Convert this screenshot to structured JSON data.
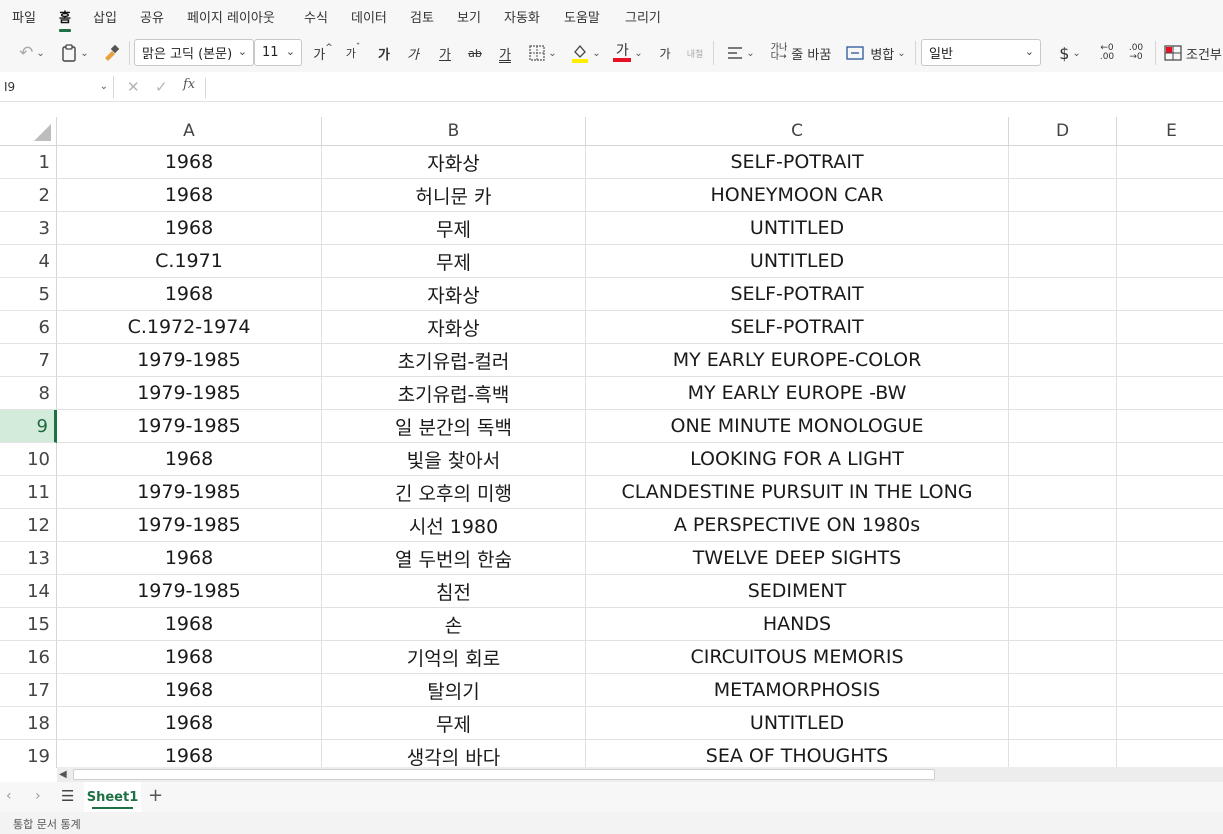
{
  "menu": {
    "items": [
      "파일",
      "홈",
      "삽입",
      "공유",
      "페이지 레이아웃",
      "수식",
      "데이터",
      "검토",
      "보기",
      "자동화",
      "도움말",
      "그리기"
    ],
    "active_index": 1
  },
  "ribbon": {
    "font_name": "맑은 고딕 (본문)",
    "font_size": "11",
    "grow_font": "가",
    "shrink_font": "가",
    "bold": "가",
    "italic": "가",
    "underline": "가",
    "strike": "ab",
    "double_underline": "가",
    "font_color": "가",
    "phonetic": "가",
    "wrap_label": "줄 바꿈",
    "merge_label": "병합",
    "number_format": "일반",
    "currency": "$",
    "conditional_label": "조건부",
    "accent_color": "#1e7145"
  },
  "formula_bar": {
    "name_box": "I9",
    "fx": "fx",
    "value": ""
  },
  "grid": {
    "columns": [
      "A",
      "B",
      "C",
      "D",
      "E"
    ],
    "selected_row": 9,
    "rows": [
      {
        "num": "1",
        "a": "1968",
        "b": "자화상",
        "c": "SELF-POTRAIT"
      },
      {
        "num": "2",
        "a": "1968",
        "b": "허니문 카",
        "c": "HONEYMOON CAR"
      },
      {
        "num": "3",
        "a": "1968",
        "b": "무제",
        "c": "UNTITLED"
      },
      {
        "num": "4",
        "a": "C.1971",
        "b": "무제",
        "c": "UNTITLED"
      },
      {
        "num": "5",
        "a": "1968",
        "b": "자화상",
        "c": "SELF-POTRAIT"
      },
      {
        "num": "6",
        "a": "C.1972-1974",
        "b": "자화상",
        "c": "SELF-POTRAIT"
      },
      {
        "num": "7",
        "a": "1979-1985",
        "b": "초기유럽-컬러",
        "c": "MY EARLY EUROPE-COLOR"
      },
      {
        "num": "8",
        "a": "1979-1985",
        "b": "초기유럽-흑백",
        "c": "MY EARLY EUROPE -BW"
      },
      {
        "num": "9",
        "a": "1979-1985",
        "b": "일 분간의 독백",
        "c": "ONE MINUTE MONOLOGUE"
      },
      {
        "num": "10",
        "a": "1968",
        "b": "빛을 찾아서",
        "c": "LOOKING FOR A LIGHT"
      },
      {
        "num": "11",
        "a": "1979-1985",
        "b": "긴 오후의 미행",
        "c": "CLANDESTINE PURSUIT IN THE LONG"
      },
      {
        "num": "12",
        "a": "1979-1985",
        "b": "시선 1980",
        "c": "A PERSPECTIVE ON 1980s"
      },
      {
        "num": "13",
        "a": "1968",
        "b": "열 두번의 한숨",
        "c": "TWELVE DEEP SIGHTS"
      },
      {
        "num": "14",
        "a": "1979-1985",
        "b": "침전",
        "c": "SEDIMENT"
      },
      {
        "num": "15",
        "a": "1968",
        "b": "손",
        "c": "HANDS"
      },
      {
        "num": "16",
        "a": "1968",
        "b": "기억의 회로",
        "c": "CIRCUITOUS MEMORIS"
      },
      {
        "num": "17",
        "a": "1968",
        "b": "탈의기",
        "c": "METAMORPHOSIS"
      },
      {
        "num": "18",
        "a": "1968",
        "b": "무제",
        "c": "UNTITLED"
      },
      {
        "num": "19",
        "a": "1968",
        "b": "생각의 바다",
        "c": "SEA OF THOUGHTS"
      }
    ]
  },
  "sheets": {
    "active": "Sheet1",
    "add": "+"
  },
  "status": {
    "text": "통합 문서 통계"
  }
}
